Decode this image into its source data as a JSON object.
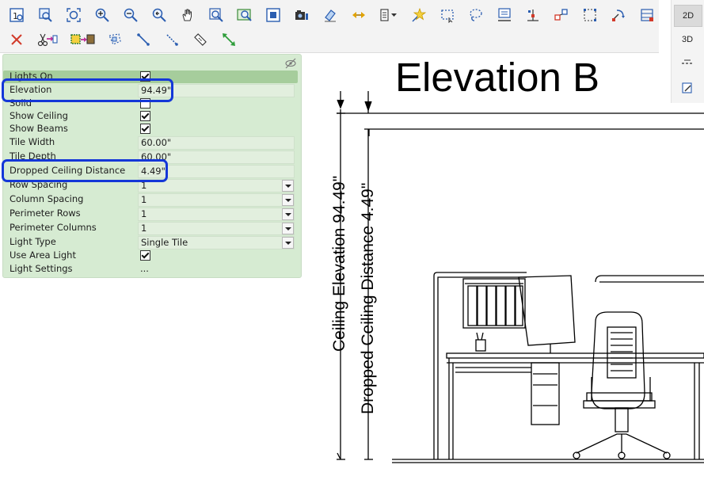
{
  "toolbar": {
    "row1": [
      "render-icon",
      "zoom-all-icon",
      "zoom-extents-icon",
      "zoom-in-icon",
      "zoom-out-icon",
      "zoom-previous-icon",
      "pan-hand-icon",
      "zoom-window-icon",
      "zoom-selection-icon",
      "fit-page-icon",
      "camera-icon",
      "erase-icon",
      "move-arrows-icon",
      "layers-dropdown-icon",
      "star-select-icon",
      "rectangle-select-icon",
      "lasso-select-icon",
      "edit-properties-icon",
      "anchor-point-icon",
      "align-objects-icon",
      "group-icon",
      "rotate-icon",
      "area-select-icon"
    ],
    "row2": [
      "delete-icon",
      "cut-paste-icon",
      "replace-icon",
      "polygon-select-icon",
      "dimension-line-icon",
      "dimension-dotted-icon",
      "measure-icon",
      "stretch-icon"
    ]
  },
  "view": {
    "btn_2d": "2D",
    "btn_3d": "3D"
  },
  "properties": {
    "rows": [
      {
        "label": "Lights On",
        "type": "checkbox",
        "checked": true
      },
      {
        "label": "Elevation",
        "type": "text",
        "value": "94.49\""
      },
      {
        "label": "Solid",
        "type": "checkbox",
        "checked": false
      },
      {
        "label": "Show Ceiling",
        "type": "checkbox",
        "checked": true
      },
      {
        "label": "Show Beams",
        "type": "checkbox",
        "checked": true
      },
      {
        "label": "Tile Width",
        "type": "text",
        "value": "60.00\""
      },
      {
        "label": "Tile Depth",
        "type": "text",
        "value": "60.00\""
      },
      {
        "label": "Dropped Ceiling Distance",
        "type": "text",
        "value": "4.49\""
      },
      {
        "label": "Row Spacing",
        "type": "select",
        "value": "1"
      },
      {
        "label": "Column Spacing",
        "type": "select",
        "value": "1"
      },
      {
        "label": "Perimeter Rows",
        "type": "select",
        "value": "1"
      },
      {
        "label": "Perimeter Columns",
        "type": "select",
        "value": "1"
      },
      {
        "label": "Light Type",
        "type": "select",
        "value": "Single Tile"
      },
      {
        "label": "Use Area Light",
        "type": "checkbox",
        "checked": true
      },
      {
        "label": "Light Settings",
        "type": "button",
        "value": "..."
      }
    ]
  },
  "drawing": {
    "title": "Elevation B",
    "dim_ceiling": "Ceiling Elevation  94.49\"",
    "dim_dropped": "Dropped Ceiling Distance  4.49\""
  },
  "colors": {
    "panel_bg": "#d6ebd2",
    "callout": "#1437d8",
    "icon_blue": "#2a5db0",
    "icon_red": "#d23a2a"
  }
}
